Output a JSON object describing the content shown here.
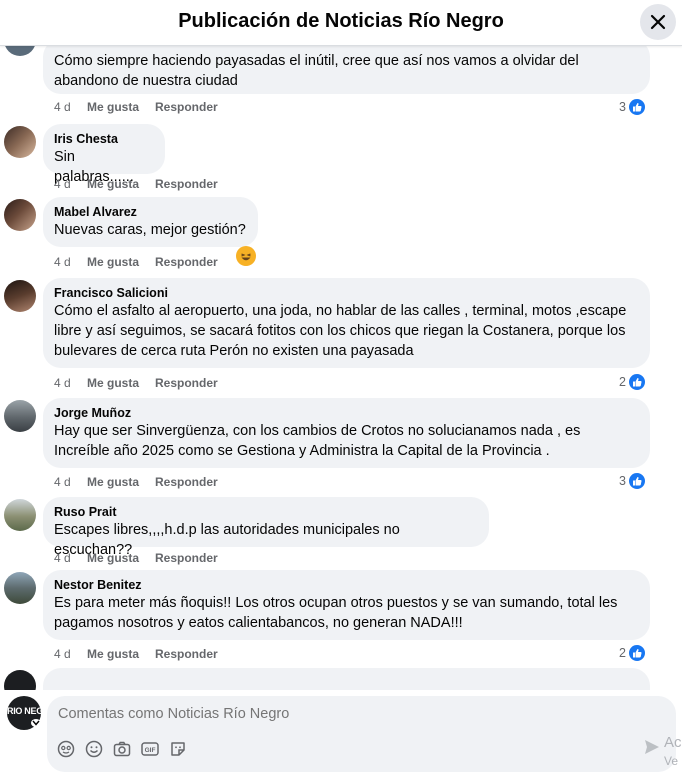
{
  "header": {
    "title": "Publicación de Noticias Río Negro"
  },
  "comments": [
    {
      "author": "",
      "text_lines": [
        "Cómo siempre haciendo payasadas el inútil, cree que así nos vamos a olvidar del",
        "abandono de nuestra ciudad"
      ],
      "time": "4 d",
      "like": "Me gusta",
      "reply": "Responder",
      "reactions": "3"
    },
    {
      "author": "Iris Chesta",
      "text_lines": [
        "Sin palabras......"
      ],
      "time": "4 d",
      "like": "Me gusta",
      "reply": "Responder",
      "reactions": ""
    },
    {
      "author": "Mabel Alvarez",
      "text_lines": [
        "Nuevas caras, mejor gestión?"
      ],
      "time": "4 d",
      "like": "Me gusta",
      "reply": "Responder",
      "reactions": "",
      "reaction_emoji": "😆"
    },
    {
      "author": "Francisco Salicioni",
      "text_lines": [
        "Cómo el asfalto al aeropuerto, una joda, no hablar de las calles , terminal, motos ,escape",
        "libre y así seguimos, se sacará fotitos con los chicos que riegan la Costanera, porque los",
        "bulevares de cerca ruta Perón no existen una payasada"
      ],
      "time": "4 d",
      "like": "Me gusta",
      "reply": "Responder",
      "reactions": "2"
    },
    {
      "author": "Jorge Muñoz",
      "text_lines": [
        "Hay que ser Sinvergüenza, con los cambios de Crotos no solucianamos nada , es",
        "Increíble año 2025 como se Gestiona y Administra la Capital de la Provincia ."
      ],
      "time": "4 d",
      "like": "Me gusta",
      "reply": "Responder",
      "reactions": "3"
    },
    {
      "author": "Ruso Prait",
      "text_lines": [
        "Escapes libres,,,,h.d.p las autoridades municipales no escuchan??"
      ],
      "time": "4 d",
      "like": "Me gusta",
      "reply": "Responder",
      "reactions": ""
    },
    {
      "author": "Nestor Benitez",
      "text_lines": [
        "Es para meter más ñoquis!! Los otros ocupan otros puestos y se van sumando, total les",
        "pagamos nosotros y eatos calientabancos, no generan NADA!!!"
      ],
      "time": "4 d",
      "like": "Me gusta",
      "reply": "Responder",
      "reactions": "2"
    }
  ],
  "composer": {
    "placeholder": "Comentas como Noticias Río Negro",
    "avatar_text": "RIO NEG",
    "overlay_line1": "Ac",
    "overlay_line2": "Ve"
  },
  "colors": {
    "like_blue": "#1877f2",
    "bubble_bg": "#f0f2f5",
    "meta_gray": "#65676b"
  }
}
